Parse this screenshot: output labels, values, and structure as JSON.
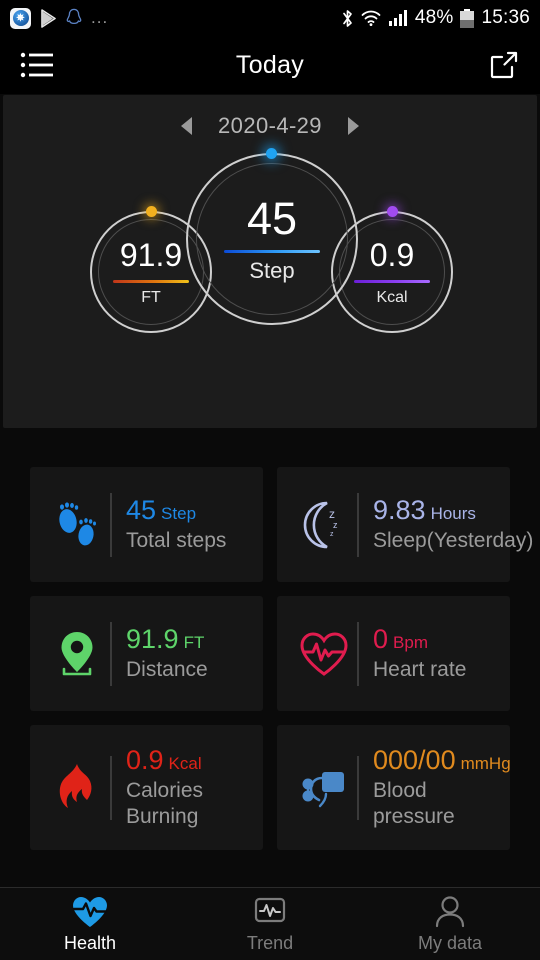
{
  "statusbar": {
    "left_icons": [
      "browser-app-icon",
      "play-store-icon",
      "qq-penguin-icon",
      "more-dots-icon"
    ],
    "more_dots": "...",
    "bluetooth_icon": "bluetooth-icon",
    "wifi_icon": "wifi-icon",
    "signal_icon": "cellular-signal-icon",
    "battery_percent": "48%",
    "battery_icon": "battery-icon",
    "time": "15:36"
  },
  "header": {
    "menu_icon": "list-menu-icon",
    "title": "Today",
    "share_icon": "share-external-link-icon"
  },
  "gauge_panel": {
    "date": "2020-4-29",
    "prev_icon": "chevron-left-icon",
    "next_icon": "chevron-right-icon",
    "rings": {
      "main": {
        "value": "45",
        "unit": "Step",
        "accent": "#2f9bf5",
        "dot": "#1fa3f2"
      },
      "left": {
        "value": "91.9",
        "unit": "FT",
        "accent": "#e0760f",
        "dot": "#f2b01f"
      },
      "right": {
        "value": "0.9",
        "unit": "Kcal",
        "accent": "#8b3ff0",
        "dot": "#a24bf0"
      }
    }
  },
  "cards": [
    {
      "icon": "footprints-icon",
      "value": "45",
      "unit": "Step",
      "label": "Total steps",
      "color": "#1e88e5",
      "label_color": "#9b9b9b"
    },
    {
      "icon": "moon-sleep-icon",
      "value": "9.83",
      "unit": "Hours",
      "label": "Sleep(Yesterday)",
      "color": "#a9b4e8",
      "label_color": "#9b9b9b"
    },
    {
      "icon": "location-pin-icon",
      "value": "91.9",
      "unit": "FT",
      "label": "Distance",
      "color": "#5ed46a",
      "label_color": "#9b9b9b"
    },
    {
      "icon": "heart-pulse-icon",
      "value": "0",
      "unit": "Bpm",
      "label": "Heart rate",
      "color": "#e01c4e",
      "label_color": "#9b9b9b"
    },
    {
      "icon": "flame-icon",
      "value": "0.9",
      "unit": "Kcal",
      "label": "Calories Burning",
      "color": "#e02318",
      "label_color": "#9b9b9b"
    },
    {
      "icon": "blood-pressure-icon",
      "value": "000/00",
      "unit": "mmHg",
      "label": "Blood pressure",
      "color": "#e08a1e",
      "label_color": "#9b9b9b"
    }
  ],
  "bottomnav": {
    "items": [
      {
        "icon": "heart-pulse-filled-icon",
        "label": "Health",
        "active": true
      },
      {
        "icon": "trend-monitor-icon",
        "label": "Trend",
        "active": false
      },
      {
        "icon": "person-icon",
        "label": "My data",
        "active": false
      }
    ]
  }
}
